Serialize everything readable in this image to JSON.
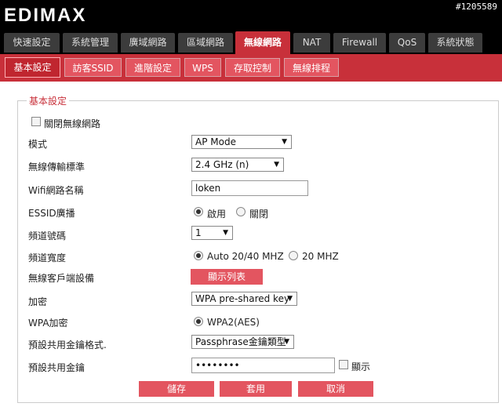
{
  "header": {
    "logo": "EDIMAX",
    "watermark": "#1205589"
  },
  "main_tabs": [
    {
      "label": "快速設定"
    },
    {
      "label": "系統管理"
    },
    {
      "label": "廣域網路"
    },
    {
      "label": "區域網路"
    },
    {
      "label": "無線網路",
      "active": true
    },
    {
      "label": "NAT"
    },
    {
      "label": "Firewall"
    },
    {
      "label": "QoS"
    },
    {
      "label": "系統狀態"
    }
  ],
  "sub_tabs": [
    {
      "label": "基本設定",
      "active": true
    },
    {
      "label": "訪客SSID"
    },
    {
      "label": "進階設定"
    },
    {
      "label": "WPS"
    },
    {
      "label": "存取控制"
    },
    {
      "label": "無線排程"
    }
  ],
  "form": {
    "legend": "基本設定",
    "disable_wireless": {
      "label": "關閉無線網路",
      "checked": false
    },
    "mode": {
      "label": "模式",
      "value": "AP Mode"
    },
    "band": {
      "label": "無線傳輸標準",
      "value": "2.4 GHz (n)"
    },
    "ssid": {
      "label": "Wifi網路名稱",
      "value": "loken"
    },
    "essid_broadcast": {
      "label": "ESSID廣播",
      "opt1": "啟用",
      "opt2": "關閉",
      "selected": "啟用"
    },
    "channel": {
      "label": "頻道號碼",
      "value": "1"
    },
    "channel_width": {
      "label": "頻道寬度",
      "opt1": "Auto 20/40 MHZ",
      "opt2": "20 MHZ",
      "selected": "Auto 20/40 MHZ"
    },
    "clients": {
      "label": "無線客戶端設備",
      "button": "顯示列表"
    },
    "encryption": {
      "label": "加密",
      "value": "WPA pre-shared key"
    },
    "wpa": {
      "label": "WPA加密",
      "opt1": "WPA2(AES)",
      "selected": "WPA2(AES)"
    },
    "key_format": {
      "label": "預設共用金鑰格式.",
      "value": "Passphrase金鑰類型"
    },
    "key": {
      "label": "預設共用金鑰",
      "value": "••••••••",
      "show_label": "顯示",
      "show_checked": false
    },
    "buttons": {
      "save": "儲存",
      "apply": "套用",
      "cancel": "取消"
    }
  },
  "colors": {
    "accent": "#c8303a",
    "tab_light": "#e35560",
    "header_bg": "#000000"
  }
}
